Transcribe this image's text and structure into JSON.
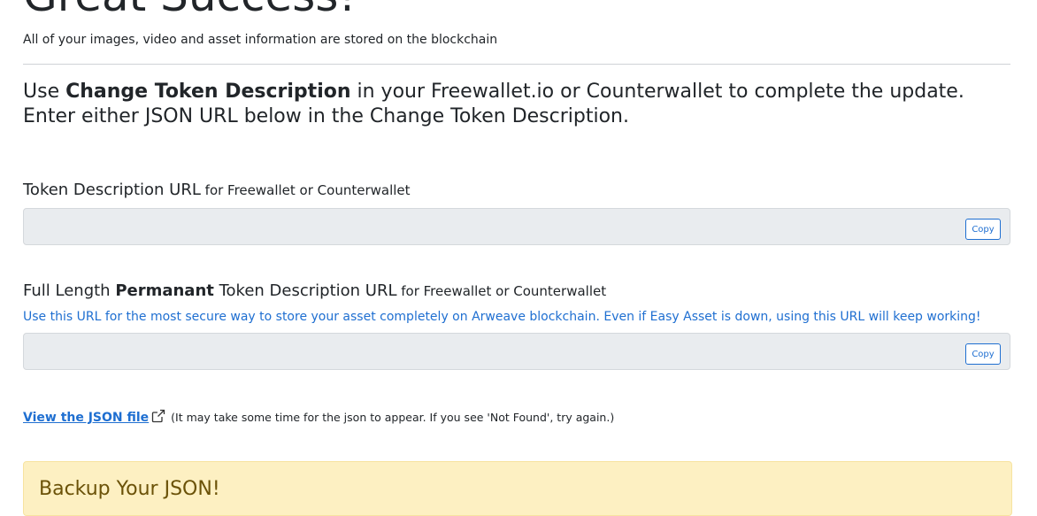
{
  "hero": {
    "title": "Great Success!",
    "subtitle": "All of your images, video and asset information are stored on the blockchain"
  },
  "lead": {
    "prefix": "Use ",
    "bold": "Change Token Description",
    "suffix": " in your Freewallet.io or Counterwallet to complete the update. Enter either JSON URL below in the Change Token Description."
  },
  "token_url": {
    "label": "Token Description URL",
    "label_small": " for Freewallet or Counterwallet",
    "value": "",
    "copy_label": "Copy"
  },
  "full_url": {
    "label_prefix": "Full Length ",
    "label_bold": "Permanant",
    "label_suffix": " Token Description URL",
    "label_small": " for Freewallet or Counterwallet",
    "note": "Use this URL for the most secure way to store your asset completely on Arweave blockchain. Even if Easy Asset is down, using this URL will keep working!",
    "value": "",
    "copy_label": "Copy"
  },
  "json_link": {
    "label": "View the JSON file",
    "icon": "external-link-icon",
    "note": " (It may take some time for the json to appear. If you see 'Not Found', try again.)"
  },
  "backup": {
    "title": "Backup Your JSON!"
  },
  "colors": {
    "link": "#1f6fd1",
    "warning_bg": "#fdf0c2",
    "warning_text": "#6b5208",
    "field_bg": "#e9ecef"
  }
}
